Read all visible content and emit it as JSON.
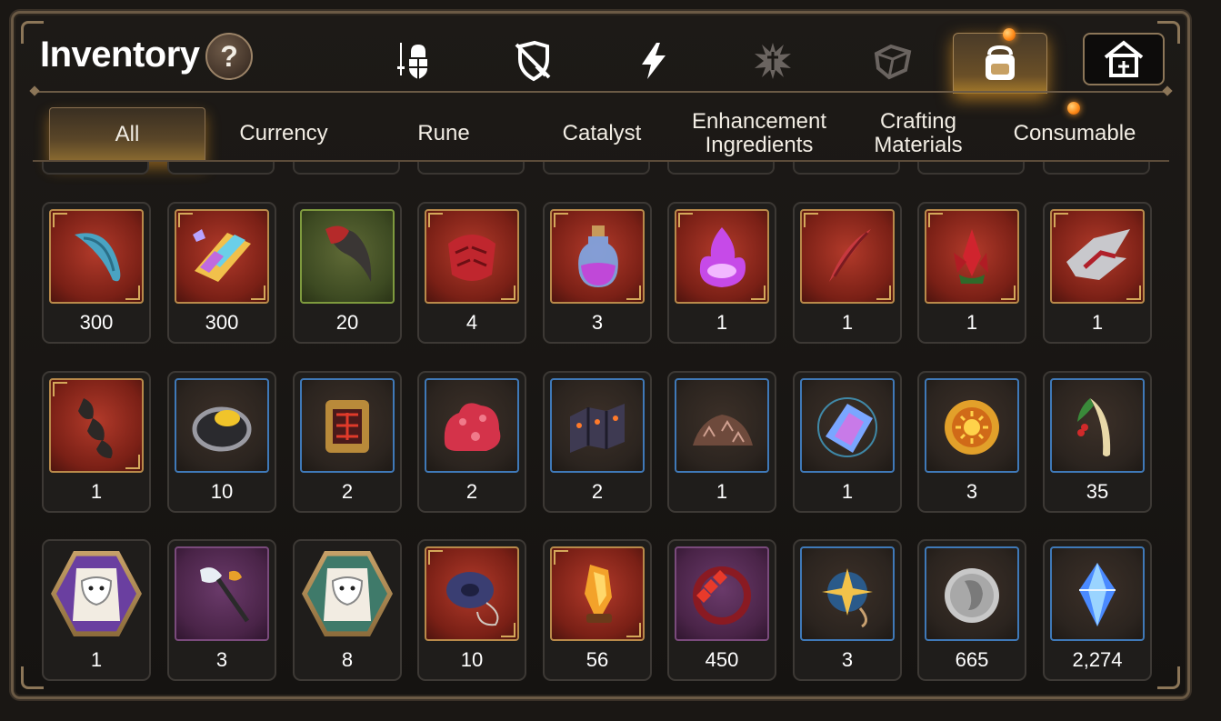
{
  "title": "Inventory",
  "help_label": "?",
  "category_tabs": [
    {
      "icon": "equipment-icon",
      "active": false
    },
    {
      "icon": "shield-sword-icon",
      "active": false
    },
    {
      "icon": "lightning-icon",
      "active": false
    },
    {
      "icon": "splat-icon",
      "active": false
    },
    {
      "icon": "dice-icon",
      "active": false
    },
    {
      "icon": "bag-icon",
      "active": true,
      "notification": true
    },
    {
      "icon": "storage-house-icon",
      "active": false
    }
  ],
  "subtabs": [
    {
      "label": "All",
      "active": true
    },
    {
      "label": "Currency",
      "active": false
    },
    {
      "label": "Rune",
      "active": false
    },
    {
      "label": "Catalyst",
      "active": false
    },
    {
      "label": "Enhancement Ingredients",
      "active": false
    },
    {
      "label": "Crafting Materials",
      "active": false
    },
    {
      "label": "Consumable",
      "active": false,
      "notification": true
    }
  ],
  "items": [
    [
      {
        "icon": "blue-horn-icon",
        "qty": "300",
        "frame": "red"
      },
      {
        "icon": "rainbow-crystal-icon",
        "qty": "300",
        "frame": "red"
      },
      {
        "icon": "claw-icon",
        "qty": "20",
        "frame": "green"
      },
      {
        "icon": "red-scales-icon",
        "qty": "4",
        "frame": "red"
      },
      {
        "icon": "potion-bottle-icon",
        "qty": "3",
        "frame": "red"
      },
      {
        "icon": "purple-flame-icon",
        "qty": "1",
        "frame": "red"
      },
      {
        "icon": "red-feather-icon",
        "qty": "1",
        "frame": "red"
      },
      {
        "icon": "red-crystal-plant-icon",
        "qty": "1",
        "frame": "red"
      },
      {
        "icon": "armor-spikes-icon",
        "qty": "1",
        "frame": "red"
      }
    ],
    [
      {
        "icon": "dark-scales-icon",
        "qty": "1",
        "frame": "red"
      },
      {
        "icon": "gold-ring-icon",
        "qty": "10",
        "frame": "blue"
      },
      {
        "icon": "circuit-plate-icon",
        "qty": "2",
        "frame": "blue"
      },
      {
        "icon": "red-slime-icon",
        "qty": "2",
        "frame": "blue"
      },
      {
        "icon": "dark-plates-icon",
        "qty": "2",
        "frame": "blue"
      },
      {
        "icon": "ore-pile-icon",
        "qty": "1",
        "frame": "blue"
      },
      {
        "icon": "blue-gem-icon",
        "qty": "1",
        "frame": "blue"
      },
      {
        "icon": "sun-coin-icon",
        "qty": "3",
        "frame": "blue"
      },
      {
        "icon": "root-herb-icon",
        "qty": "35",
        "frame": "blue"
      }
    ],
    [
      {
        "icon": "pet-food-bag-icon",
        "qty": "1",
        "frame": "pet",
        "bag_color": "#6a3fa0"
      },
      {
        "icon": "feather-wand-icon",
        "qty": "3",
        "frame": "purple"
      },
      {
        "icon": "pet-food-bag-icon",
        "qty": "8",
        "frame": "pet",
        "bag_color": "#3f7a6a"
      },
      {
        "icon": "yoyo-icon",
        "qty": "10",
        "frame": "red"
      },
      {
        "icon": "golden-relic-icon",
        "qty": "56",
        "frame": "red"
      },
      {
        "icon": "flower-bracelet-icon",
        "qty": "450",
        "frame": "purple"
      },
      {
        "icon": "star-amulet-icon",
        "qty": "3",
        "frame": "blue"
      },
      {
        "icon": "silver-coin-icon",
        "qty": "665",
        "frame": "blue"
      },
      {
        "icon": "blue-diamond-icon",
        "qty": "2,274",
        "frame": "blue"
      }
    ]
  ]
}
